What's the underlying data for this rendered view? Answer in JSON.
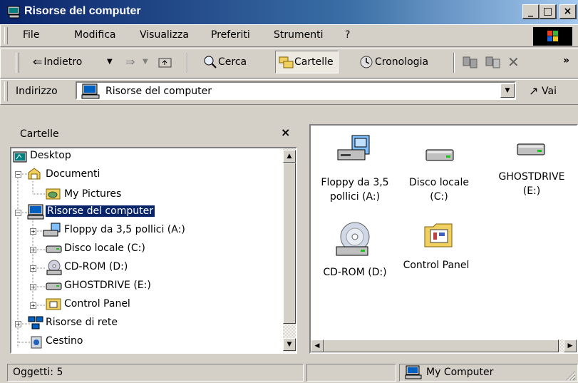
{
  "window": {
    "title": "Risorse del computer"
  },
  "titlebar_buttons": {
    "minimize": "_",
    "maximize": "□",
    "close": "×"
  },
  "menu": [
    "File",
    "Modifica",
    "Visualizza",
    "Preferiti",
    "Strumenti",
    "?"
  ],
  "toolbar": {
    "back": "Indietro",
    "search": "Cerca",
    "folders": "Cartelle",
    "history": "Cronologia",
    "overflow": "»"
  },
  "address": {
    "label": "Indirizzo",
    "value": "Risorse del computer",
    "go": "Vai"
  },
  "folders_pane": {
    "title": "Cartelle",
    "close": "×",
    "tree": [
      {
        "label": "Desktop"
      },
      {
        "label": "Documenti"
      },
      {
        "label": "My Pictures"
      },
      {
        "label": "Risorse del computer"
      },
      {
        "label": "Floppy da 3,5 pollici (A:)"
      },
      {
        "label": "Disco locale (C:)"
      },
      {
        "label": "CD-ROM (D:)"
      },
      {
        "label": "GHOSTDRIVE (E:)"
      },
      {
        "label": "Control Panel"
      },
      {
        "label": "Risorse di rete"
      },
      {
        "label": "Cestino"
      }
    ]
  },
  "content_items": [
    {
      "line1": "Floppy da 3,5",
      "line2": "pollici (A:)"
    },
    {
      "line1": "Disco locale",
      "line2": "(C:)"
    },
    {
      "line1": "GHOSTDRIVE",
      "line2": "(E:)"
    },
    {
      "line1": "CD-ROM (D:)",
      "line2": ""
    },
    {
      "line1": "Control Panel",
      "line2": ""
    }
  ],
  "status": {
    "count": "Oggetti: 5",
    "zone": "My Computer"
  },
  "colors": {
    "title_bar": "#0a246a",
    "selection": "#0a246a",
    "face": "#d4d0c8"
  }
}
